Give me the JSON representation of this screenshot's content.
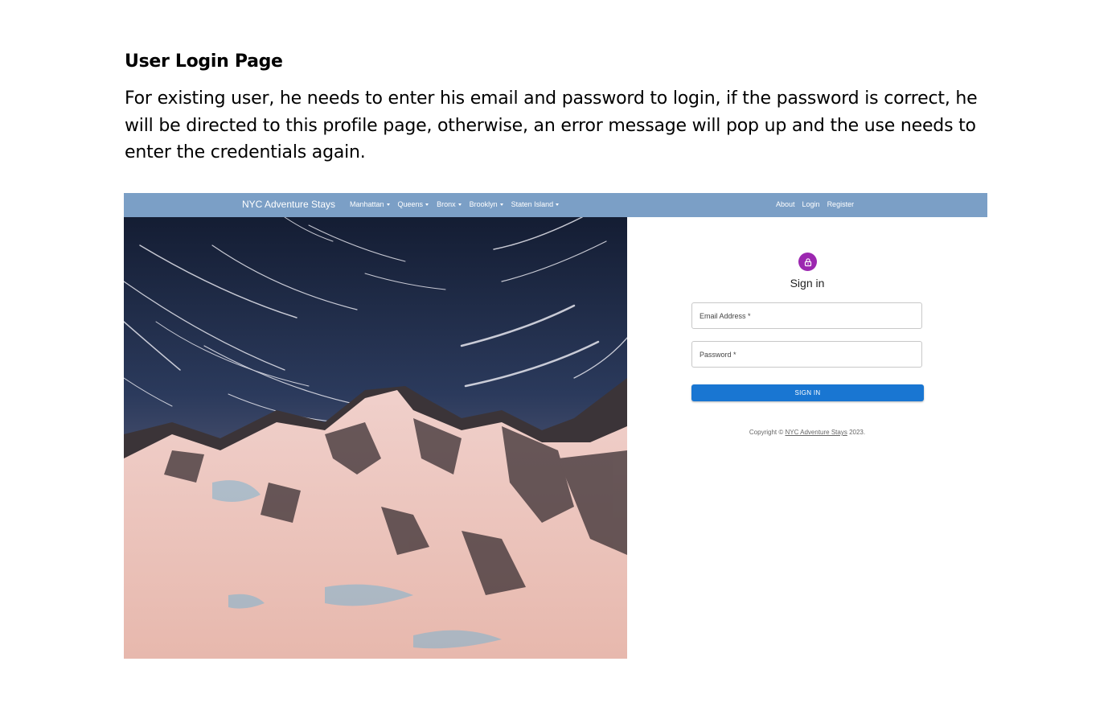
{
  "document": {
    "heading": "User Login Page",
    "paragraph": "For existing user, he needs to enter his email and password to login, if the password is correct, he will be directed to this profile page, otherwise, an error message will pop up and the use needs to enter the credentials again."
  },
  "navbar": {
    "brand": "NYC Adventure Stays",
    "menu": [
      "Manhattan",
      "Queens",
      "Bronx",
      "Brooklyn",
      "Staten Island"
    ],
    "right": [
      "About",
      "Login",
      "Register"
    ],
    "background": "#7b9fc6"
  },
  "hero": {
    "icon": "snowy-mountain-star-trails-photo"
  },
  "signin": {
    "icon": "lock-icon",
    "icon_color": "#9c27b0",
    "title": "Sign in",
    "email_label": "Email Address *",
    "password_label": "Password *",
    "button": "SIGN IN",
    "button_color": "#1976d2"
  },
  "footer": {
    "prefix": "Copyright © ",
    "link": "NYC Adventure Stays",
    "suffix": " 2023."
  }
}
